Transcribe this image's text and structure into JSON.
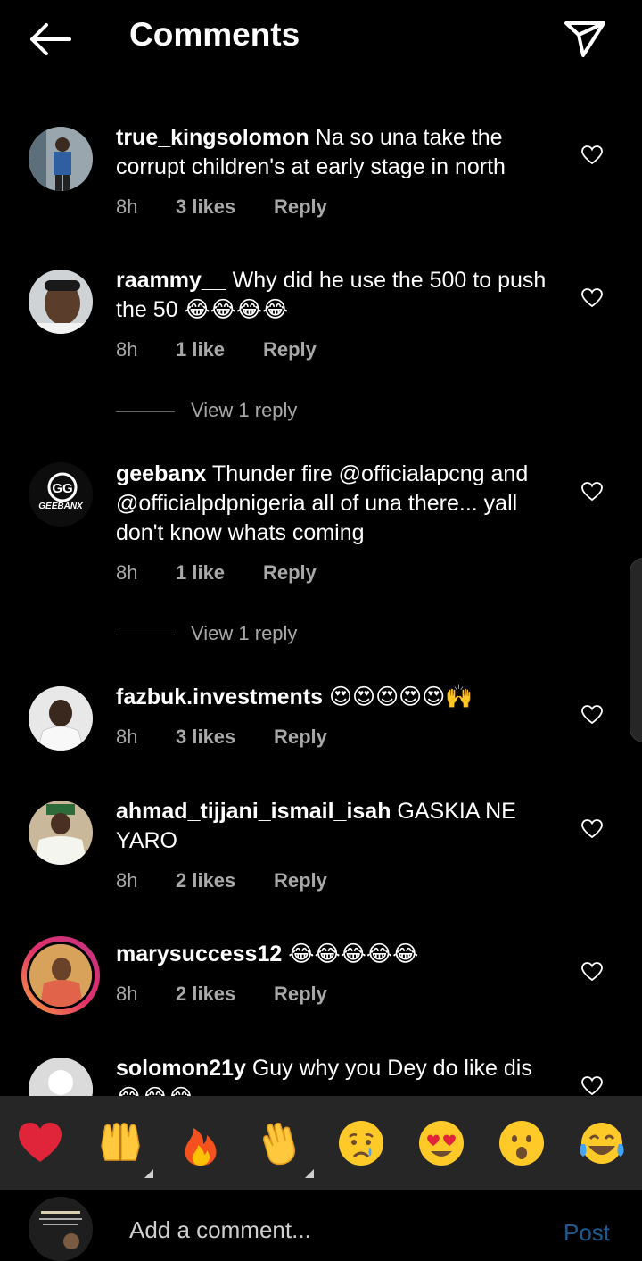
{
  "header": {
    "title": "Comments"
  },
  "comments": [
    {
      "username": "true_kingsolomon",
      "text": " Na so una take the corrupt children's at early stage in north",
      "time": "8h",
      "likes": "3 likes",
      "reply": "Reply"
    },
    {
      "username": "raammy__",
      "text": " Why did he use the 500 to push the 50 😂😂😂😂",
      "time": "8h",
      "likes": "1 like",
      "reply": "Reply",
      "view_replies": "View 1 reply"
    },
    {
      "username": "geebanx",
      "text": " Thunder fire @officialapcng and @officialpdpnigeria all of una there... yall  don't know whats coming",
      "time": "8h",
      "likes": "1 like",
      "reply": "Reply",
      "view_replies": "View 1 reply",
      "avatar_text": "GEEBANX"
    },
    {
      "username": "fazbuk.investments",
      "text": " 😍😍😍😍😍🙌",
      "time": "8h",
      "likes": "3 likes",
      "reply": "Reply"
    },
    {
      "username": "ahmad_tijjani_ismail_isah",
      "text": " GASKIA NE YARO",
      "time": "8h",
      "likes": "2 likes",
      "reply": "Reply"
    },
    {
      "username": "marysuccess12",
      "text": " 😂😂😂😂😂",
      "time": "8h",
      "likes": "2 likes",
      "reply": "Reply"
    },
    {
      "username": "solomon21y",
      "text": " Guy why you Dey do like dis 😂😂😂",
      "time": "",
      "likes": "",
      "reply": ""
    }
  ],
  "quick_reactions": [
    "❤️",
    "🙌",
    "🔥",
    "👏",
    "😢",
    "😍",
    "😮",
    "😂"
  ],
  "composer": {
    "placeholder": "Add a comment...",
    "post_label": "Post"
  },
  "colors": {
    "background": "#000000",
    "secondary_text": "#a8a8a8",
    "post_disabled": "#1d5a8f",
    "emoji_bar": "#262626"
  }
}
